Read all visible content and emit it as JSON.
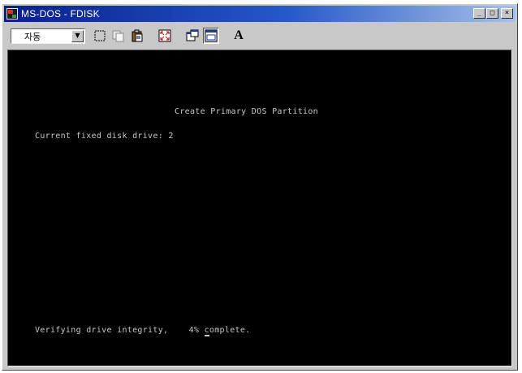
{
  "window": {
    "title": "MS-DOS - FDISK",
    "controls": {
      "minimize": "_",
      "maximize": "□",
      "close": "×"
    }
  },
  "toolbar": {
    "font_size_select": "자동",
    "dropdown_arrow": "▼",
    "font_button": "A",
    "tools": [
      "mark-icon",
      "copy-icon",
      "paste-icon",
      "fullscreen-icon",
      "properties-icon",
      "background-icon",
      "font-icon"
    ]
  },
  "console": {
    "heading": "Create Primary DOS Partition",
    "drive_line": "Current fixed disk drive: 2",
    "status_prefix": "Verifying drive integrity,    4% ",
    "status_cursor_char": "c",
    "status_suffix": "omplete."
  },
  "colors": {
    "title_bar_start": "#0a1f8c",
    "console_bg": "#000000",
    "console_text": "#c8c8c8",
    "window_face": "#c8c8c8"
  }
}
